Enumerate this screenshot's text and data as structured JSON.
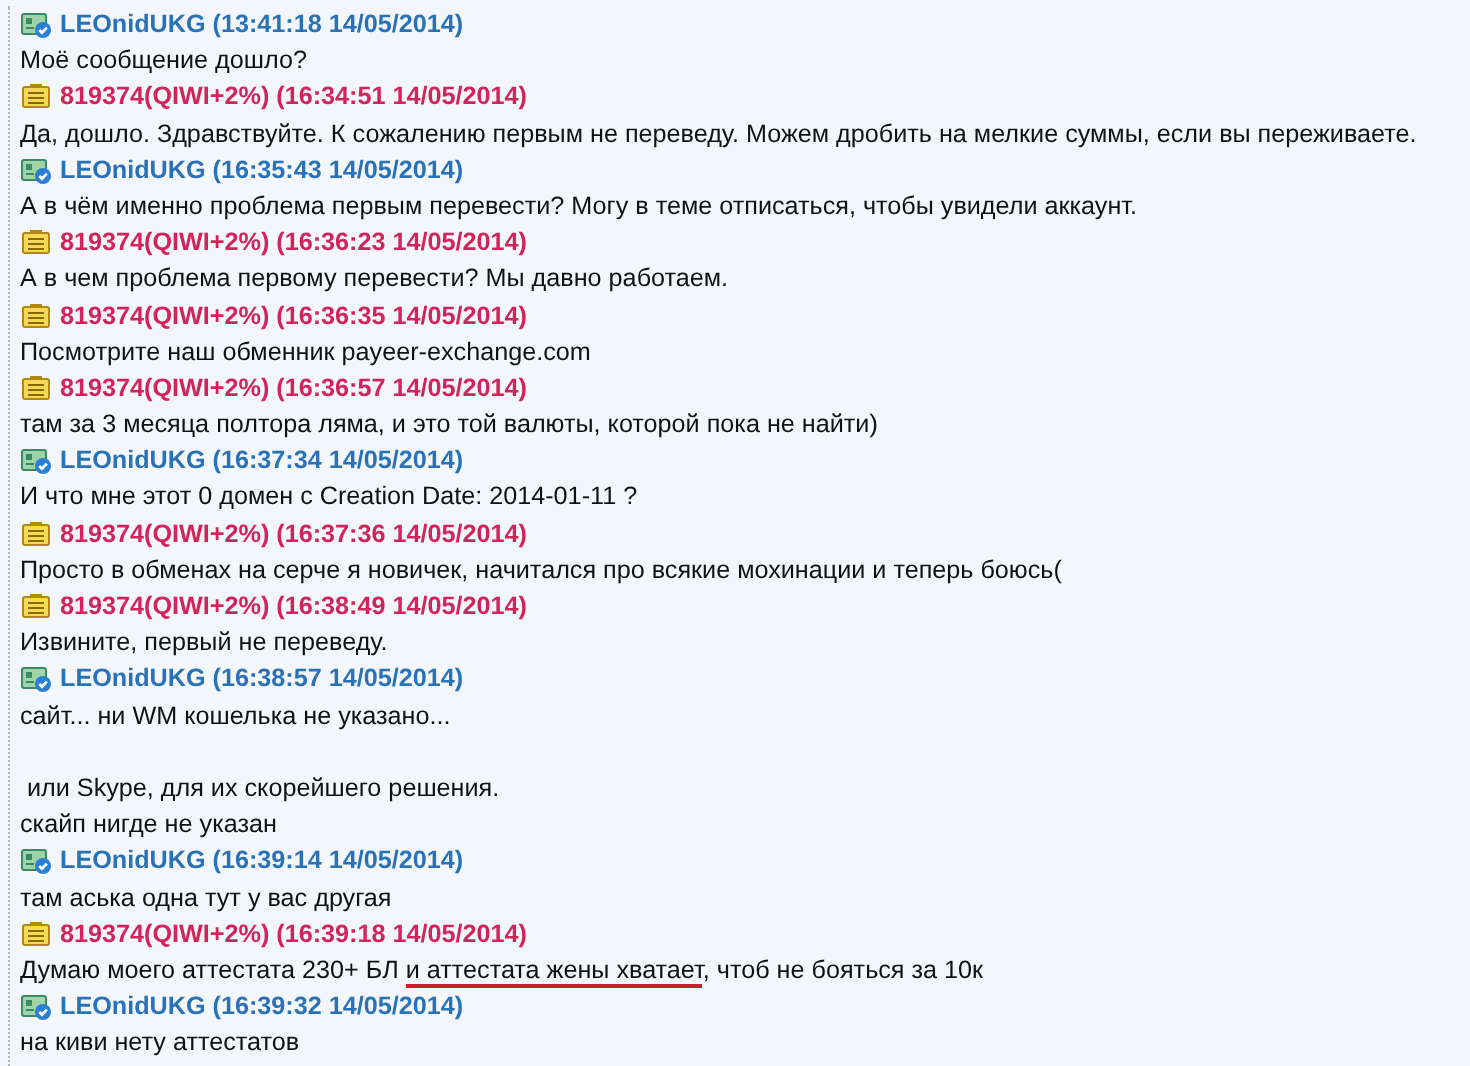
{
  "messages": [
    {
      "kind": "visitor",
      "author": "LEOnidUKG",
      "time": "(13:41:18 14/05/2014)",
      "paragraphs": [
        [
          {
            "segments": [
              {
                "text": "Моё сообщение дошло?",
                "underlined": false
              }
            ]
          }
        ]
      ]
    },
    {
      "kind": "operator",
      "author": "819374(QIWI+2%)",
      "time": "(16:34:51 14/05/2014)",
      "paragraphs": [
        [
          {
            "segments": [
              {
                "text": "Да, дошло. Здравствуйте. К сожалению первым не переведу. Можем дробить на мелкие суммы, если вы переживаете.",
                "underlined": false
              }
            ]
          }
        ]
      ]
    },
    {
      "kind": "visitor",
      "author": "LEOnidUKG",
      "time": "(16:35:43 14/05/2014)",
      "paragraphs": [
        [
          {
            "segments": [
              {
                "text": "А в чём именно проблема первым перевести? Могу в теме отписаться, чтобы увидели аккаунт.",
                "underlined": false
              }
            ]
          }
        ]
      ]
    },
    {
      "kind": "operator",
      "author": "819374(QIWI+2%)",
      "time": "(16:36:23 14/05/2014)",
      "paragraphs": [
        [
          {
            "segments": [
              {
                "text": "А в чем проблема первому перевести? Мы давно работаем.",
                "underlined": false
              }
            ]
          }
        ]
      ]
    },
    {
      "kind": "operator",
      "author": "819374(QIWI+2%)",
      "time": "(16:36:35 14/05/2014)",
      "paragraphs": [
        [
          {
            "segments": [
              {
                "text": "Посмотрите наш обменник payeer-exchange.com",
                "underlined": false
              }
            ]
          }
        ]
      ]
    },
    {
      "kind": "operator",
      "author": "819374(QIWI+2%)",
      "time": "(16:36:57 14/05/2014)",
      "paragraphs": [
        [
          {
            "segments": [
              {
                "text": "там за 3 месяца полтора ляма, и это той валюты, которой пока не найти)",
                "underlined": false
              }
            ]
          }
        ]
      ]
    },
    {
      "kind": "visitor",
      "author": "LEOnidUKG",
      "time": "(16:37:34 14/05/2014)",
      "paragraphs": [
        [
          {
            "segments": [
              {
                "text": "И что мне этот 0 домен с Creation Date: 2014-01-11 ?",
                "underlined": false
              }
            ]
          }
        ]
      ]
    },
    {
      "kind": "operator",
      "author": "819374(QIWI+2%)",
      "time": "(16:37:36 14/05/2014)",
      "paragraphs": [
        [
          {
            "segments": [
              {
                "text": "Просто в обменах на серче я новичек, начитался про всякие мохинации и теперь боюсь(",
                "underlined": false
              }
            ]
          }
        ]
      ]
    },
    {
      "kind": "operator",
      "author": "819374(QIWI+2%)",
      "time": "(16:38:49 14/05/2014)",
      "paragraphs": [
        [
          {
            "segments": [
              {
                "text": "Извините, первый не переведу.",
                "underlined": false
              }
            ]
          }
        ]
      ]
    },
    {
      "kind": "visitor",
      "author": "LEOnidUKG",
      "time": "(16:38:57 14/05/2014)",
      "paragraphs": [
        [
          {
            "segments": [
              {
                "text": "сайт... ни WM кошелька не указано...",
                "underlined": false
              }
            ]
          }
        ],
        [
          {
            "segments": [
              {
                "text": " или Skype, для их скорейшего решения.",
                "underlined": false
              }
            ]
          },
          {
            "segments": [
              {
                "text": "скайп нигде не указан",
                "underlined": false
              }
            ]
          }
        ]
      ]
    },
    {
      "kind": "visitor",
      "author": "LEOnidUKG",
      "time": "(16:39:14 14/05/2014)",
      "paragraphs": [
        [
          {
            "segments": [
              {
                "text": "там аська одна тут у вас другая",
                "underlined": false
              }
            ]
          }
        ]
      ]
    },
    {
      "kind": "operator",
      "author": "819374(QIWI+2%)",
      "time": "(16:39:18 14/05/2014)",
      "paragraphs": [
        [
          {
            "segments": [
              {
                "text": "Думаю моего аттестата 230+ БЛ ",
                "underlined": false
              },
              {
                "text": "и аттестата жены хватает",
                "underlined": true
              },
              {
                "text": ", чтоб не бояться за 10к",
                "underlined": false
              }
            ]
          }
        ]
      ]
    },
    {
      "kind": "visitor",
      "author": "LEOnidUKG",
      "time": "(16:39:32 14/05/2014)",
      "paragraphs": [
        [
          {
            "segments": [
              {
                "text": "на киви нету аттестатов",
                "underlined": false
              }
            ]
          }
        ]
      ]
    }
  ]
}
